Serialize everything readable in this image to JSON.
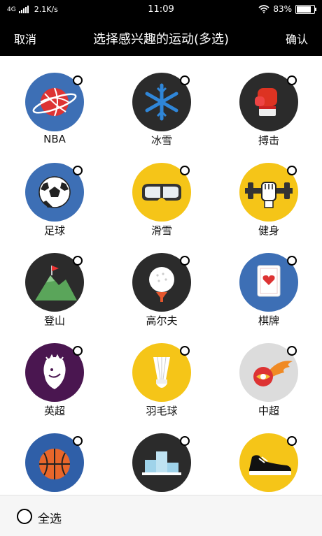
{
  "status_bar": {
    "network": "4G",
    "speed": "2.1K/s",
    "time": "11:09",
    "battery": "83%",
    "battery_level": 0.83
  },
  "nav": {
    "cancel_label": "取消",
    "title": "选择感兴趣的运动(多选)",
    "confirm_label": "确认"
  },
  "sports": [
    {
      "name": "NBA",
      "icon": "basketball-planet-icon",
      "bg": "#3d6fb5"
    },
    {
      "name": "冰雪",
      "icon": "snowflake-icon",
      "bg": "#2b2b2b"
    },
    {
      "name": "搏击",
      "icon": "boxing-glove-icon",
      "bg": "#2b2b2b"
    },
    {
      "name": "足球",
      "icon": "soccer-ball-icon",
      "bg": "#3d6fb5"
    },
    {
      "name": "滑雪",
      "icon": "ski-goggles-icon",
      "bg": "#f5c518"
    },
    {
      "name": "健身",
      "icon": "dumbbell-fist-icon",
      "bg": "#f5c518"
    },
    {
      "name": "登山",
      "icon": "mountain-flag-icon",
      "bg": "#2b2b2b"
    },
    {
      "name": "高尔夫",
      "icon": "golf-ball-icon",
      "bg": "#2b2b2b"
    },
    {
      "name": "棋牌",
      "icon": "playing-card-icon",
      "bg": "#3d6fb5"
    },
    {
      "name": "英超",
      "icon": "lion-crest-icon",
      "bg": "#4a1650"
    },
    {
      "name": "羽毛球",
      "icon": "shuttlecock-icon",
      "bg": "#f5c518"
    },
    {
      "name": "中超",
      "icon": "flaming-ball-icon",
      "bg": "#dcdcdc"
    },
    {
      "name": "",
      "icon": "basketball-icon",
      "bg": "#2f5fa8"
    },
    {
      "name": "",
      "icon": "podium-icon",
      "bg": "#2b2b2b"
    },
    {
      "name": "",
      "icon": "sneaker-icon",
      "bg": "#f5c518"
    }
  ],
  "bottom": {
    "select_all_label": "全选"
  }
}
